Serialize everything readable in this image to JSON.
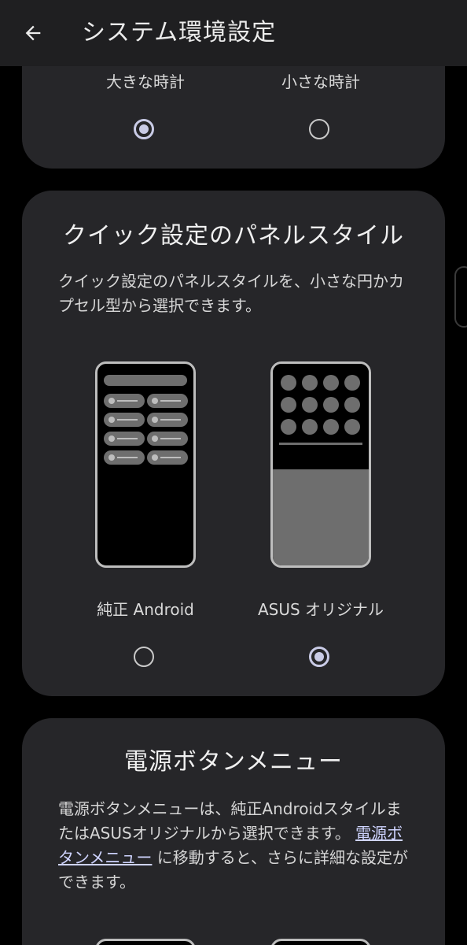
{
  "appbar": {
    "title": "システム環境設定",
    "back_icon": "arrow-left-icon"
  },
  "clock_card": {
    "options": [
      {
        "label": "大きな時計",
        "selected": true
      },
      {
        "label": "小さな時計",
        "selected": false
      }
    ]
  },
  "quick_settings_card": {
    "title": "クイック設定のパネルスタイル",
    "description": "クイック設定のパネルスタイルを、小さな円かカプセル型から選択できます。",
    "options": [
      {
        "label": "純正 Android",
        "selected": false
      },
      {
        "label": "ASUS オリジナル",
        "selected": true
      }
    ]
  },
  "power_menu_card": {
    "title": "電源ボタンメニュー",
    "description_before": "電源ボタンメニューは、純正Androidスタイルまたは",
    "description_after_asus": "ASUSオリジナルから選択できます。",
    "link_text": "電源ボタンメニュー",
    "description_end": "に移動すると、さらに詳細な設定ができます。"
  },
  "colors": {
    "background": "#000000",
    "card": "#262629",
    "accent": "#c9cbe6"
  }
}
